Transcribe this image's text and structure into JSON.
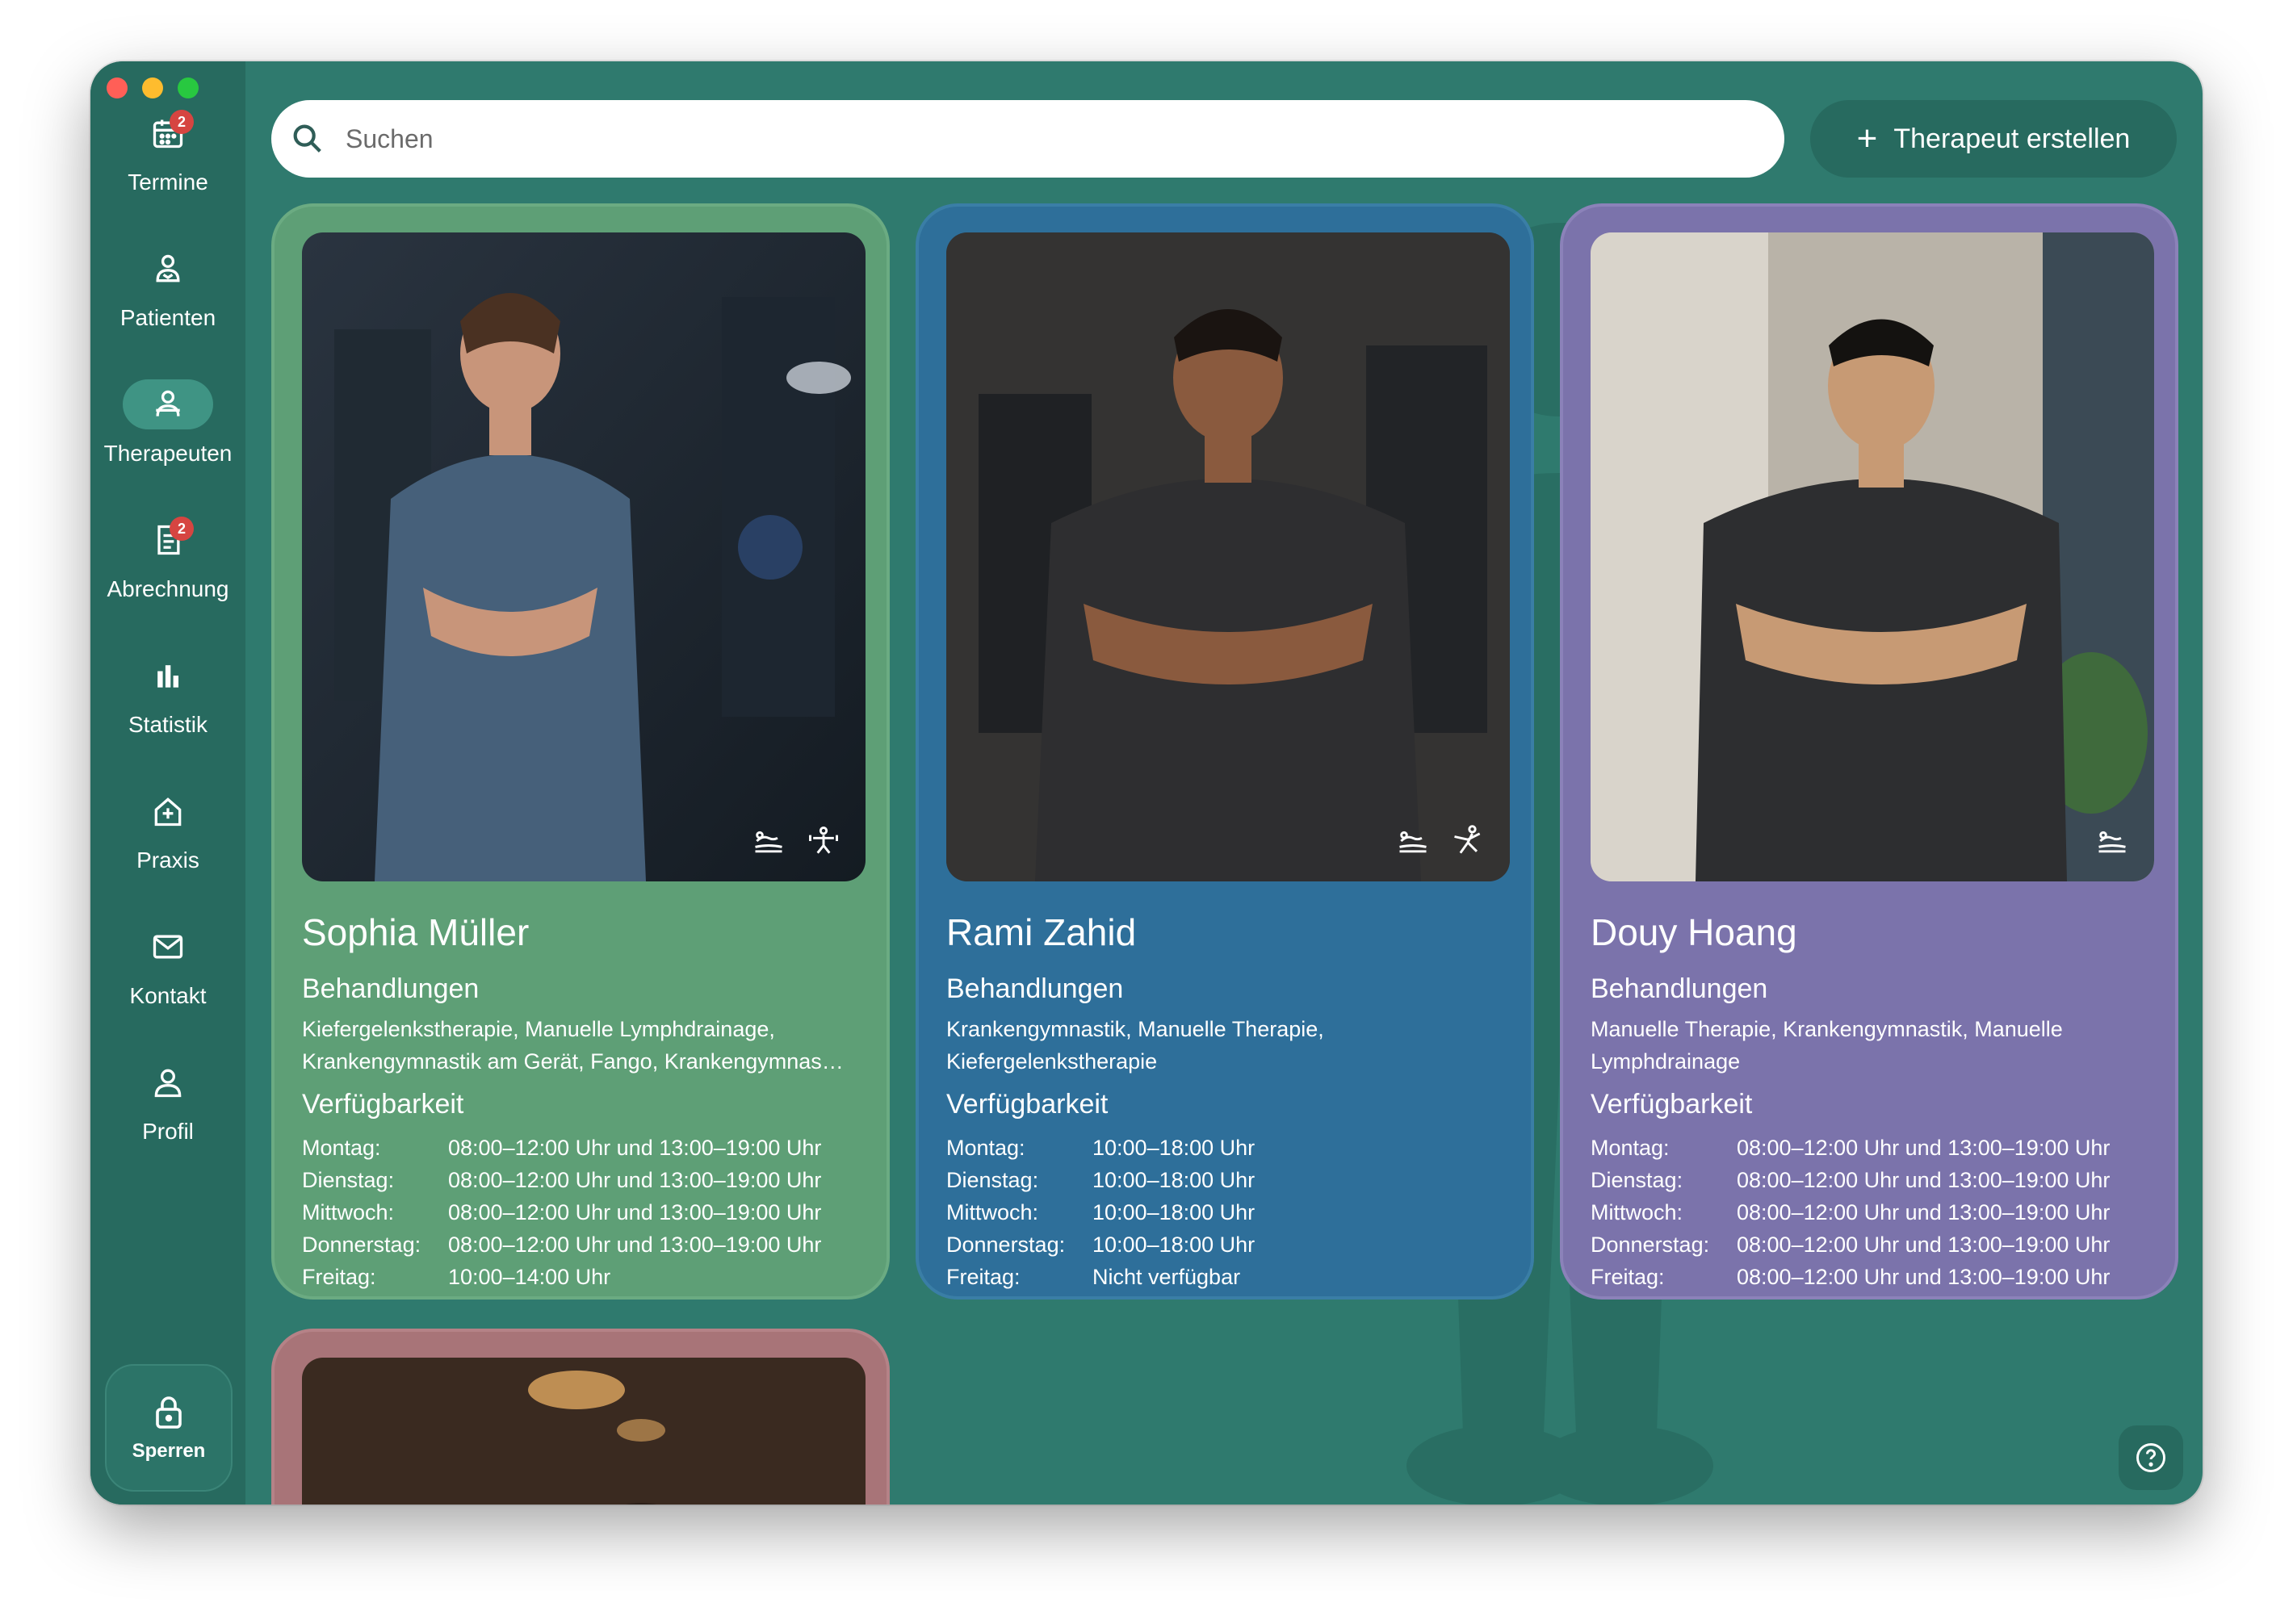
{
  "sidebar": {
    "items": [
      {
        "label": "Termine",
        "icon": "calendar-icon",
        "badge": "2"
      },
      {
        "label": "Patienten",
        "icon": "patient-icon"
      },
      {
        "label": "Therapeuten",
        "icon": "therapist-icon",
        "active": true
      },
      {
        "label": "Abrechnung",
        "icon": "invoice-icon",
        "badge": "2"
      },
      {
        "label": "Statistik",
        "icon": "bar-chart-icon"
      },
      {
        "label": "Praxis",
        "icon": "practice-icon"
      },
      {
        "label": "Kontakt",
        "icon": "mail-icon"
      },
      {
        "label": "Profil",
        "icon": "profile-icon"
      }
    ],
    "lock_label": "Sperren"
  },
  "search": {
    "placeholder": "Suchen",
    "value": ""
  },
  "create_button": {
    "label": "Therapeut erstellen"
  },
  "therapists": [
    {
      "name": "Sophia Müller",
      "color": "#5e9f76",
      "treatments_title": "Behandlungen",
      "treatments": "Kiefergelenkstherapie, Manuelle Lymphdrainage, Krankengymnastik am Gerät, Fango, Krankengymnas…",
      "availability_title": "Verfügbarkeit",
      "schedule": [
        {
          "day": "Montag:",
          "time": "08:00–12:00 Uhr und 13:00–19:00 Uhr"
        },
        {
          "day": "Dienstag:",
          "time": "08:00–12:00 Uhr und 13:00–19:00 Uhr"
        },
        {
          "day": "Mittwoch:",
          "time": "08:00–12:00 Uhr und 13:00–19:00 Uhr"
        },
        {
          "day": "Donnerstag:",
          "time": "08:00–12:00 Uhr und 13:00–19:00 Uhr"
        },
        {
          "day": "Freitag:",
          "time": "10:00–14:00 Uhr"
        }
      ],
      "photo_icons": [
        "massage-icon",
        "dumbbell-icon"
      ]
    },
    {
      "name": "Rami Zahid",
      "color": "#2e6f9a",
      "treatments_title": "Behandlungen",
      "treatments": "Krankengymnastik, Manuelle Therapie, Kiefergelenkstherapie",
      "availability_title": "Verfügbarkeit",
      "schedule": [
        {
          "day": "Montag:",
          "time": "10:00–18:00 Uhr"
        },
        {
          "day": "Dienstag:",
          "time": "10:00–18:00 Uhr"
        },
        {
          "day": "Mittwoch:",
          "time": "10:00–18:00 Uhr"
        },
        {
          "day": "Donnerstag:",
          "time": "10:00–18:00 Uhr"
        },
        {
          "day": "Freitag:",
          "time": "Nicht verfügbar"
        }
      ],
      "photo_icons": [
        "massage-icon",
        "exercise-icon"
      ]
    },
    {
      "name": "Douy Hoang",
      "color": "#7b73ab",
      "treatments_title": "Behandlungen",
      "treatments": "Manuelle Therapie, Krankengymnastik, Manuelle Lymphdrainage",
      "availability_title": "Verfügbarkeit",
      "schedule": [
        {
          "day": "Montag:",
          "time": "08:00–12:00 Uhr und 13:00–19:00 Uhr"
        },
        {
          "day": "Dienstag:",
          "time": "08:00–12:00 Uhr und 13:00–19:00 Uhr"
        },
        {
          "day": "Mittwoch:",
          "time": "08:00–12:00 Uhr und 13:00–19:00 Uhr"
        },
        {
          "day": "Donnerstag:",
          "time": "08:00–12:00 Uhr und 13:00–19:00 Uhr"
        },
        {
          "day": "Freitag:",
          "time": "08:00–12:00 Uhr und 13:00–19:00 Uhr"
        }
      ],
      "photo_icons": [
        "massage-icon"
      ]
    }
  ],
  "help_icon": "help-icon"
}
